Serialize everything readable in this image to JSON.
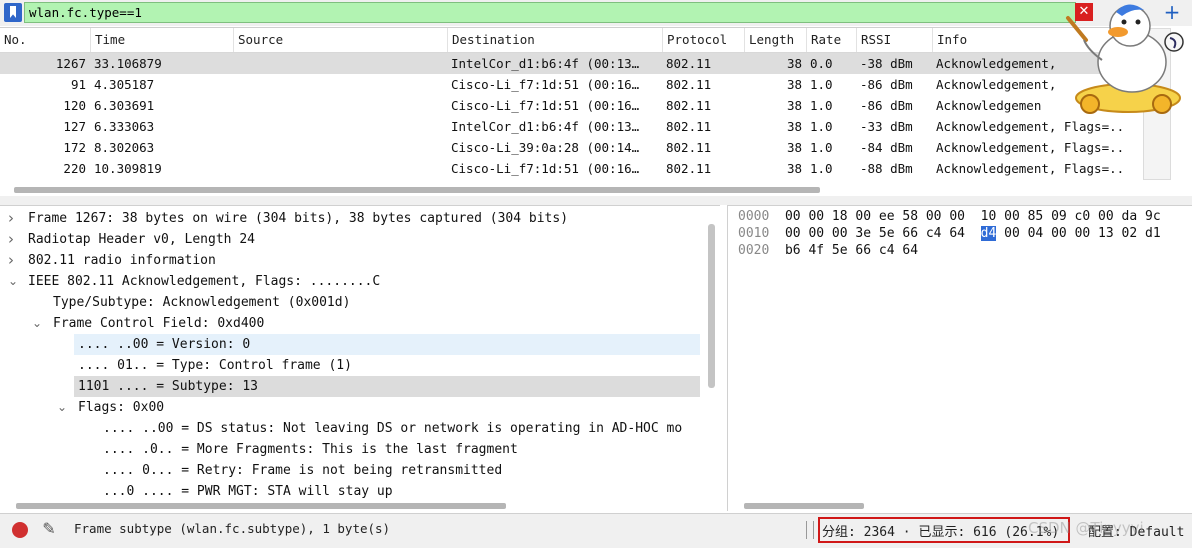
{
  "filter": {
    "value": "wlan.fc.type==1",
    "colors": {
      "valid_bg": "#b2f3b2",
      "bookmark": "#2f66c9",
      "clear": "#d92020"
    }
  },
  "packet_list": {
    "columns": [
      "No.",
      "Time",
      "Source",
      "Destination",
      "Protocol",
      "Length",
      "Rate",
      "RSSI",
      "Info"
    ],
    "rows": [
      {
        "no": "1267",
        "time": "33.106879",
        "source": "",
        "destination": "IntelCor_d1:b6:4f (00:13…",
        "protocol": "802.11",
        "length": "38",
        "rate": "0.0",
        "rssi": "-38 dBm",
        "info": "Acknowledgement, ",
        "selected": true
      },
      {
        "no": "91",
        "time": "4.305187",
        "source": "",
        "destination": "Cisco-Li_f7:1d:51 (00:16…",
        "protocol": "802.11",
        "length": "38",
        "rate": "1.0",
        "rssi": "-86 dBm",
        "info": "Acknowledgement, ",
        "selected": false
      },
      {
        "no": "120",
        "time": "6.303691",
        "source": "",
        "destination": "Cisco-Li_f7:1d:51 (00:16…",
        "protocol": "802.11",
        "length": "38",
        "rate": "1.0",
        "rssi": "-86 dBm",
        "info": "Acknowledgemen",
        "selected": false
      },
      {
        "no": "127",
        "time": "6.333063",
        "source": "",
        "destination": "IntelCor_d1:b6:4f (00:13…",
        "protocol": "802.11",
        "length": "38",
        "rate": "1.0",
        "rssi": "-33 dBm",
        "info": "Acknowledgement, Flags=..",
        "selected": false
      },
      {
        "no": "172",
        "time": "8.302063",
        "source": "",
        "destination": "Cisco-Li_39:0a:28 (00:14…",
        "protocol": "802.11",
        "length": "38",
        "rate": "1.0",
        "rssi": "-84 dBm",
        "info": "Acknowledgement, Flags=..",
        "selected": false
      },
      {
        "no": "220",
        "time": "10.309819",
        "source": "",
        "destination": "Cisco-Li_f7:1d:51 (00:16…",
        "protocol": "802.11",
        "length": "38",
        "rate": "1.0",
        "rssi": "-88 dBm",
        "info": "Acknowledgement, Flags=..",
        "selected": false
      }
    ]
  },
  "detail_tree": [
    {
      "text": "Frame 1267: 38 bytes on wire (304 bits), 38 bytes captured (304 bits)",
      "arrow": "›",
      "level": 0,
      "highlight": ""
    },
    {
      "text": "Radiotap Header v0, Length 24",
      "arrow": "›",
      "level": 0,
      "highlight": ""
    },
    {
      "text": "802.11 radio information",
      "arrow": "›",
      "level": 0,
      "highlight": ""
    },
    {
      "text": "IEEE 802.11 Acknowledgement, Flags: ........C",
      "arrow": "⌄",
      "level": 0,
      "highlight": ""
    },
    {
      "text": "Type/Subtype: Acknowledgement (0x001d)",
      "arrow": "",
      "level": 1,
      "highlight": ""
    },
    {
      "text": "Frame Control Field: 0xd400",
      "arrow": "⌄",
      "level": 1,
      "highlight": ""
    },
    {
      "text": ".... ..00 = Version: 0",
      "arrow": "",
      "level": 2,
      "highlight": "blue"
    },
    {
      "text": ".... 01.. = Type: Control frame (1)",
      "arrow": "",
      "level": 2,
      "highlight": ""
    },
    {
      "text": "1101 .... = Subtype: 13",
      "arrow": "",
      "level": 2,
      "highlight": "gray"
    },
    {
      "text": "Flags: 0x00",
      "arrow": "⌄",
      "level": 2,
      "highlight": ""
    },
    {
      "text": ".... ..00 = DS status: Not leaving DS or network is operating in AD-HOC mo",
      "arrow": "",
      "level": 3,
      "highlight": ""
    },
    {
      "text": ".... .0.. = More Fragments: This is the last fragment",
      "arrow": "",
      "level": 3,
      "highlight": ""
    },
    {
      "text": ".... 0... = Retry: Frame is not being retransmitted",
      "arrow": "",
      "level": 3,
      "highlight": ""
    },
    {
      "text": "...0 .... = PWR MGT: STA will stay up",
      "arrow": "",
      "level": 3,
      "highlight": ""
    }
  ],
  "hex": [
    {
      "offset": "0000",
      "pre": "00 00 18 00 ee 58 00 00  10 00 85 09 c0 00 da 9c",
      "sel": "",
      "post": ""
    },
    {
      "offset": "0010",
      "pre": "00 00 00 3e 5e 66 c4 64  ",
      "sel": "d4",
      "post": " 00 04 00 00 13 02 d1"
    },
    {
      "offset": "0020",
      "pre": "b6 4f 5e 66 c4 64",
      "sel": "",
      "post": ""
    }
  ],
  "status": {
    "field": "Frame subtype (wlan.fc.subtype), 1 byte(s)",
    "counts": "分组: 2364 · 已显示: 616 (26.1%)",
    "profile": "配置: Default",
    "watermark": "CSDN @Tinyyyi"
  }
}
